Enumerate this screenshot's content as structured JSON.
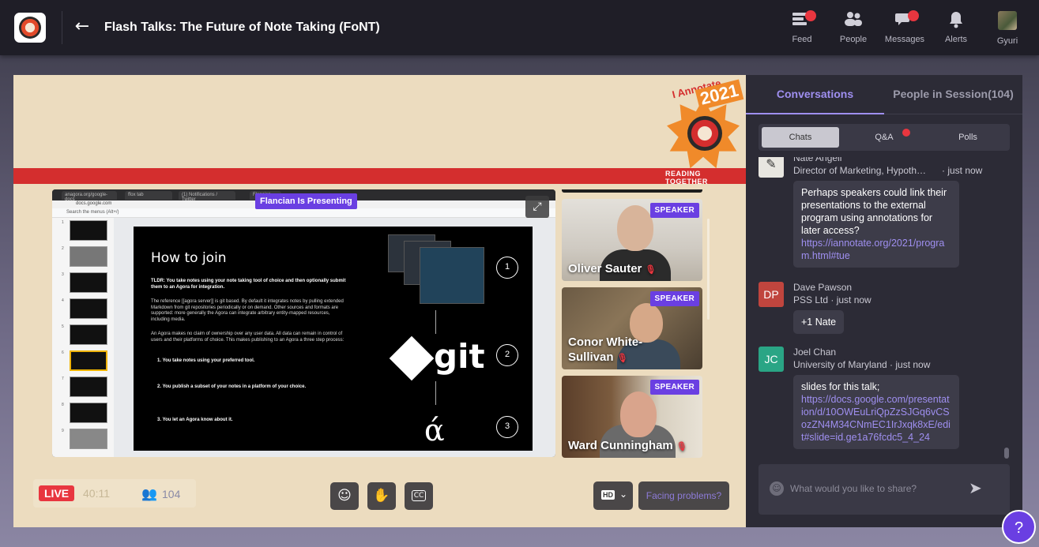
{
  "header": {
    "title": "Flash Talks: The Future of Note Taking (FoNT)",
    "nav": [
      {
        "label": "Feed",
        "icon": "feed-icon",
        "badge": true
      },
      {
        "label": "People",
        "icon": "people-icon",
        "badge": false
      },
      {
        "label": "Messages",
        "icon": "messages-icon",
        "badge": true
      },
      {
        "label": "Alerts",
        "icon": "bell-icon",
        "badge": false
      },
      {
        "label": "Gyuri",
        "icon": "avatar",
        "badge": false
      }
    ]
  },
  "stage": {
    "brand": {
      "line1": "I Annotate",
      "line2": "2021",
      "tagline": "READING TOGETHER"
    },
    "presenting_label": "Flancian Is Presenting",
    "slide": {
      "heading": "How to join",
      "tldr": "TLDR: You take notes using your note taking tool of choice and then optionally submit them to an Agora for integration.",
      "p1": "The reference [[agora server]] is git based. By default it integrates notes by pulling extended Markdown from git repositories periodically or on demand. Other sources and formats are supported: more generally the Agora can integrate arbitrary entity-mapped resources, including media.",
      "p2": "An Agora makes no claim of ownership over any user data. All data can remain in control of users and their platforms of choice. This makes publishing to an Agora a three step process:",
      "steps": [
        "1. You take notes using your preferred tool.",
        "2. You publish a subset of your notes in a platform of your choice.",
        "3. You let an Agora know about it."
      ],
      "git_label": "git",
      "alpha": "ά",
      "numbers": [
        "1",
        "2",
        "3"
      ]
    },
    "browser_tabs": [
      "anagora.org/google-docs",
      "ffox tab",
      "(1) Notifications / Twitter",
      "Flancian"
    ],
    "url": "docs.google.com",
    "docs_menu": "Search the menus (Alt+/)",
    "speakers": [
      {
        "name": "Oliver Sauter",
        "badge": "SPEAKER"
      },
      {
        "name": "Conor White-Sullivan",
        "badge": "SPEAKER"
      },
      {
        "name": "Ward Cunningham",
        "badge": "SPEAKER"
      }
    ],
    "controls": {
      "live": "LIVE",
      "timer": "40:11",
      "viewers": "104",
      "quality": "HD",
      "facing_problems": "Facing problems?"
    }
  },
  "panel": {
    "tabs": [
      "Conversations",
      "People in Session(104)"
    ],
    "segments": [
      "Chats",
      "Q&A",
      "Polls"
    ],
    "messages": [
      {
        "initials": "",
        "name": "Nate Angell",
        "sub": "Director of Marketing, Hypoth…",
        "time": "· just now",
        "text": "Perhaps speakers could link their presentations to the external program using annotations for later access?",
        "link": "https://iannotate.org/2021/program.html#tue"
      },
      {
        "initials": "DP",
        "name": "Dave Pawson",
        "sub": "PSS Ltd · just now",
        "text": "+1 Nate"
      },
      {
        "initials": "JC",
        "name": "Joel Chan",
        "sub": "University of Maryland · just now",
        "text": "slides for this talk;",
        "link": "https://docs.google.com/presentation/d/10OWEuLriQpZzSJGq6vCSozZN4M34CNmEC1IrJxqk8xE/edit#slide=id.ge1a76fcdc5_4_24"
      }
    ],
    "composer_placeholder": "What would you like to share?"
  },
  "help_label": "?",
  "colors": {
    "accent": "#6a3fe2",
    "live": "#e8363f",
    "stage_bg": "#ecdcbf",
    "panel_bg": "#2c2b36"
  }
}
